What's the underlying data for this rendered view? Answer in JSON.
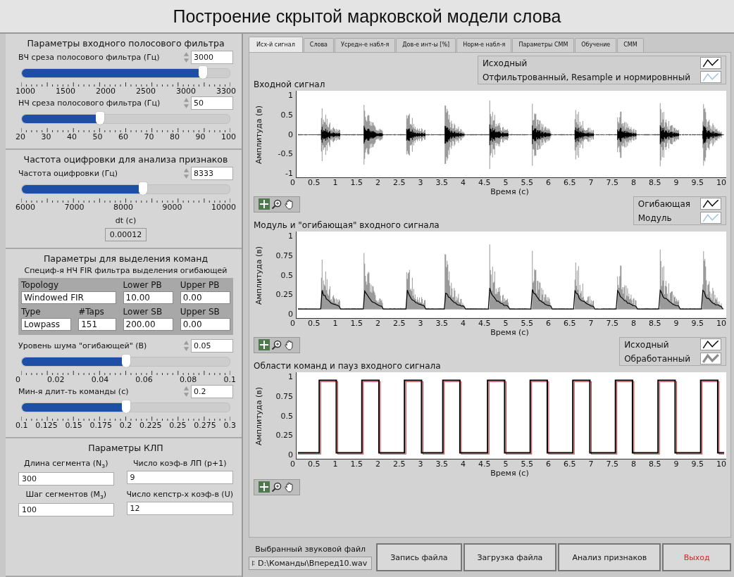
{
  "title": "Построение скрытой марковской модели слова",
  "left_sections": [
    {
      "heading": "Параметры входного полосового фильтра",
      "items": [
        {
          "kind": "slider",
          "label": "ВЧ среза полосового фильтра (Гц)",
          "value": "3000",
          "level": 0.87,
          "ticks": [
            "1000",
            "1500",
            "2000",
            "2500",
            "3000",
            "3300"
          ]
        },
        {
          "kind": "slider",
          "label": "НЧ среза полосового фильтра (Гц)",
          "value": "50",
          "level": 0.375,
          "ticks": [
            "20",
            "30",
            "40",
            "50",
            "60",
            "70",
            "80",
            "90",
            "100"
          ]
        }
      ]
    },
    {
      "heading": "Частота оцифровки для анализа признаков",
      "items": [
        {
          "kind": "slider",
          "label": "Частота оцифровки (Гц)",
          "value": "8333",
          "level": 0.583,
          "ticks": [
            "6000",
            "7000",
            "8000",
            "9000",
            "10000"
          ]
        },
        {
          "kind": "readout",
          "label": "dt (c)",
          "value": "0.00012"
        }
      ]
    },
    {
      "heading": "Параметры для выделения команд",
      "items": [
        {
          "kind": "fir",
          "heading": "Специф-я НЧ FIR фильтра выделения огибающей",
          "fields": [
            {
              "label": "Topology",
              "value": "Windowed FIR"
            },
            {
              "label": "Lower PB",
              "value": "10.00"
            },
            {
              "label": "Upper PB",
              "value": "0.00"
            },
            {
              "label": "Type",
              "value": "Lowpass"
            },
            {
              "label": "#Taps",
              "value": "151"
            },
            {
              "label": "Lower SB",
              "value": "200.00"
            },
            {
              "label": "Upper SB",
              "value": "0.00"
            }
          ]
        },
        {
          "kind": "slider",
          "label": "Уровень шума \"огибающей\" (В)",
          "value": "0.05",
          "level": 0.5,
          "ticks": [
            "0",
            "0.02",
            "0.04",
            "0.06",
            "0.08",
            "0.1"
          ]
        },
        {
          "kind": "slider",
          "label": "Мин-я длит-ть команды (с)",
          "value": "0.2",
          "level": 0.5,
          "ticks": [
            "0.1",
            "0.125",
            "0.15",
            "0.175",
            "0.2",
            "0.225",
            "0.25",
            "0.275",
            "0.3"
          ]
        }
      ]
    },
    {
      "heading": "Параметры КЛП",
      "items": [
        {
          "kind": "fields",
          "fields": [
            {
              "label": "Длина сегмента (N$_{з}$)",
              "value": "300"
            },
            {
              "label": "Число коэф-в ЛП (p+1)",
              "value": "9"
            },
            {
              "label": "Шаг сегментов (M$_{з}$)",
              "value": "100"
            },
            {
              "label": "Число кепстр-х коэф-в (U)",
              "value": "12"
            }
          ]
        }
      ]
    }
  ],
  "tabs": [
    {
      "label": "Исх-й сигнал",
      "selected": true
    },
    {
      "label": "Слова",
      "selected": false
    },
    {
      "label": "Усредн-е набл-я",
      "selected": false
    },
    {
      "label": "Дов-е инт-ы [%]",
      "selected": false
    },
    {
      "label": "Норм-е набл-я",
      "selected": false
    },
    {
      "label": "Параметры СММ",
      "selected": false
    },
    {
      "label": "Обучение",
      "selected": false
    },
    {
      "label": "СММ",
      "selected": false
    }
  ],
  "charts": [
    {
      "kind": "waveform",
      "title": "Входной сигнал",
      "legend": [
        {
          "label": "Исходный",
          "color": "#000000"
        },
        {
          "label": "Отфильтрованный, Resample и нормировнный",
          "color": "#9ec3dc"
        }
      ],
      "ylabel": "Амплитуда (в)",
      "yticks": [
        "1",
        "0.5",
        "0",
        "-0.5",
        "-1"
      ],
      "xlabel": "Время (с)",
      "xticks": [
        "0",
        "0.5",
        "1",
        "1.5",
        "2",
        "2.5",
        "3",
        "3.5",
        "4",
        "4.5",
        "5",
        "5.5",
        "6",
        "6.5",
        "7",
        "7.5",
        "8",
        "8.5",
        "9",
        "9.5",
        "10"
      ]
    },
    {
      "kind": "envelope",
      "title": "Модуль и \"огибающая\" входного сигнала",
      "legend": [
        {
          "label": "Огибающая",
          "color": "#000000"
        },
        {
          "label": "Модуль",
          "color": "#9ec3dc"
        }
      ],
      "ylabel": "Амплитуда (в)",
      "yticks": [
        "1",
        "0.75",
        "0.5",
        "0.25",
        "0"
      ],
      "xlabel": "Время (с)",
      "xticks": [
        "0",
        "0.5",
        "1",
        "1.5",
        "2",
        "2.5",
        "3",
        "3.5",
        "4",
        "4.5",
        "5",
        "5.5",
        "6",
        "6.5",
        "7",
        "7.5",
        "8",
        "8.5",
        "9",
        "9.5",
        "10"
      ]
    },
    {
      "kind": "regions",
      "title": "Области команд и пауз входного сигнала",
      "legend": [
        {
          "label": "Исходный",
          "color": "#000000"
        },
        {
          "label": "Обработанный",
          "color": "#8c8c8c"
        }
      ],
      "ylabel": "Амплитуда (в)",
      "yticks": [
        "1",
        "0.75",
        "0.5",
        "0.25",
        "0"
      ],
      "xlabel": "Время (с)",
      "xticks": [
        "0",
        "0.5",
        "1",
        "1.5",
        "2",
        "2.5",
        "3",
        "3.5",
        "4",
        "4.5",
        "5",
        "5.5",
        "6",
        "6.5",
        "7",
        "7.5",
        "8",
        "8.5",
        "9",
        "9.5",
        "10"
      ]
    }
  ],
  "file": {
    "label": "Выбранный звуковой файл",
    "path": "D:\\Команды\\Вперед10.wav"
  },
  "buttons": [
    {
      "label": "Запись файла",
      "kind": "normal"
    },
    {
      "label": "Загрузка файла",
      "kind": "normal"
    },
    {
      "label": "Анализ признаков",
      "kind": "normal"
    },
    {
      "label": "Выход",
      "kind": "exit"
    }
  ]
}
